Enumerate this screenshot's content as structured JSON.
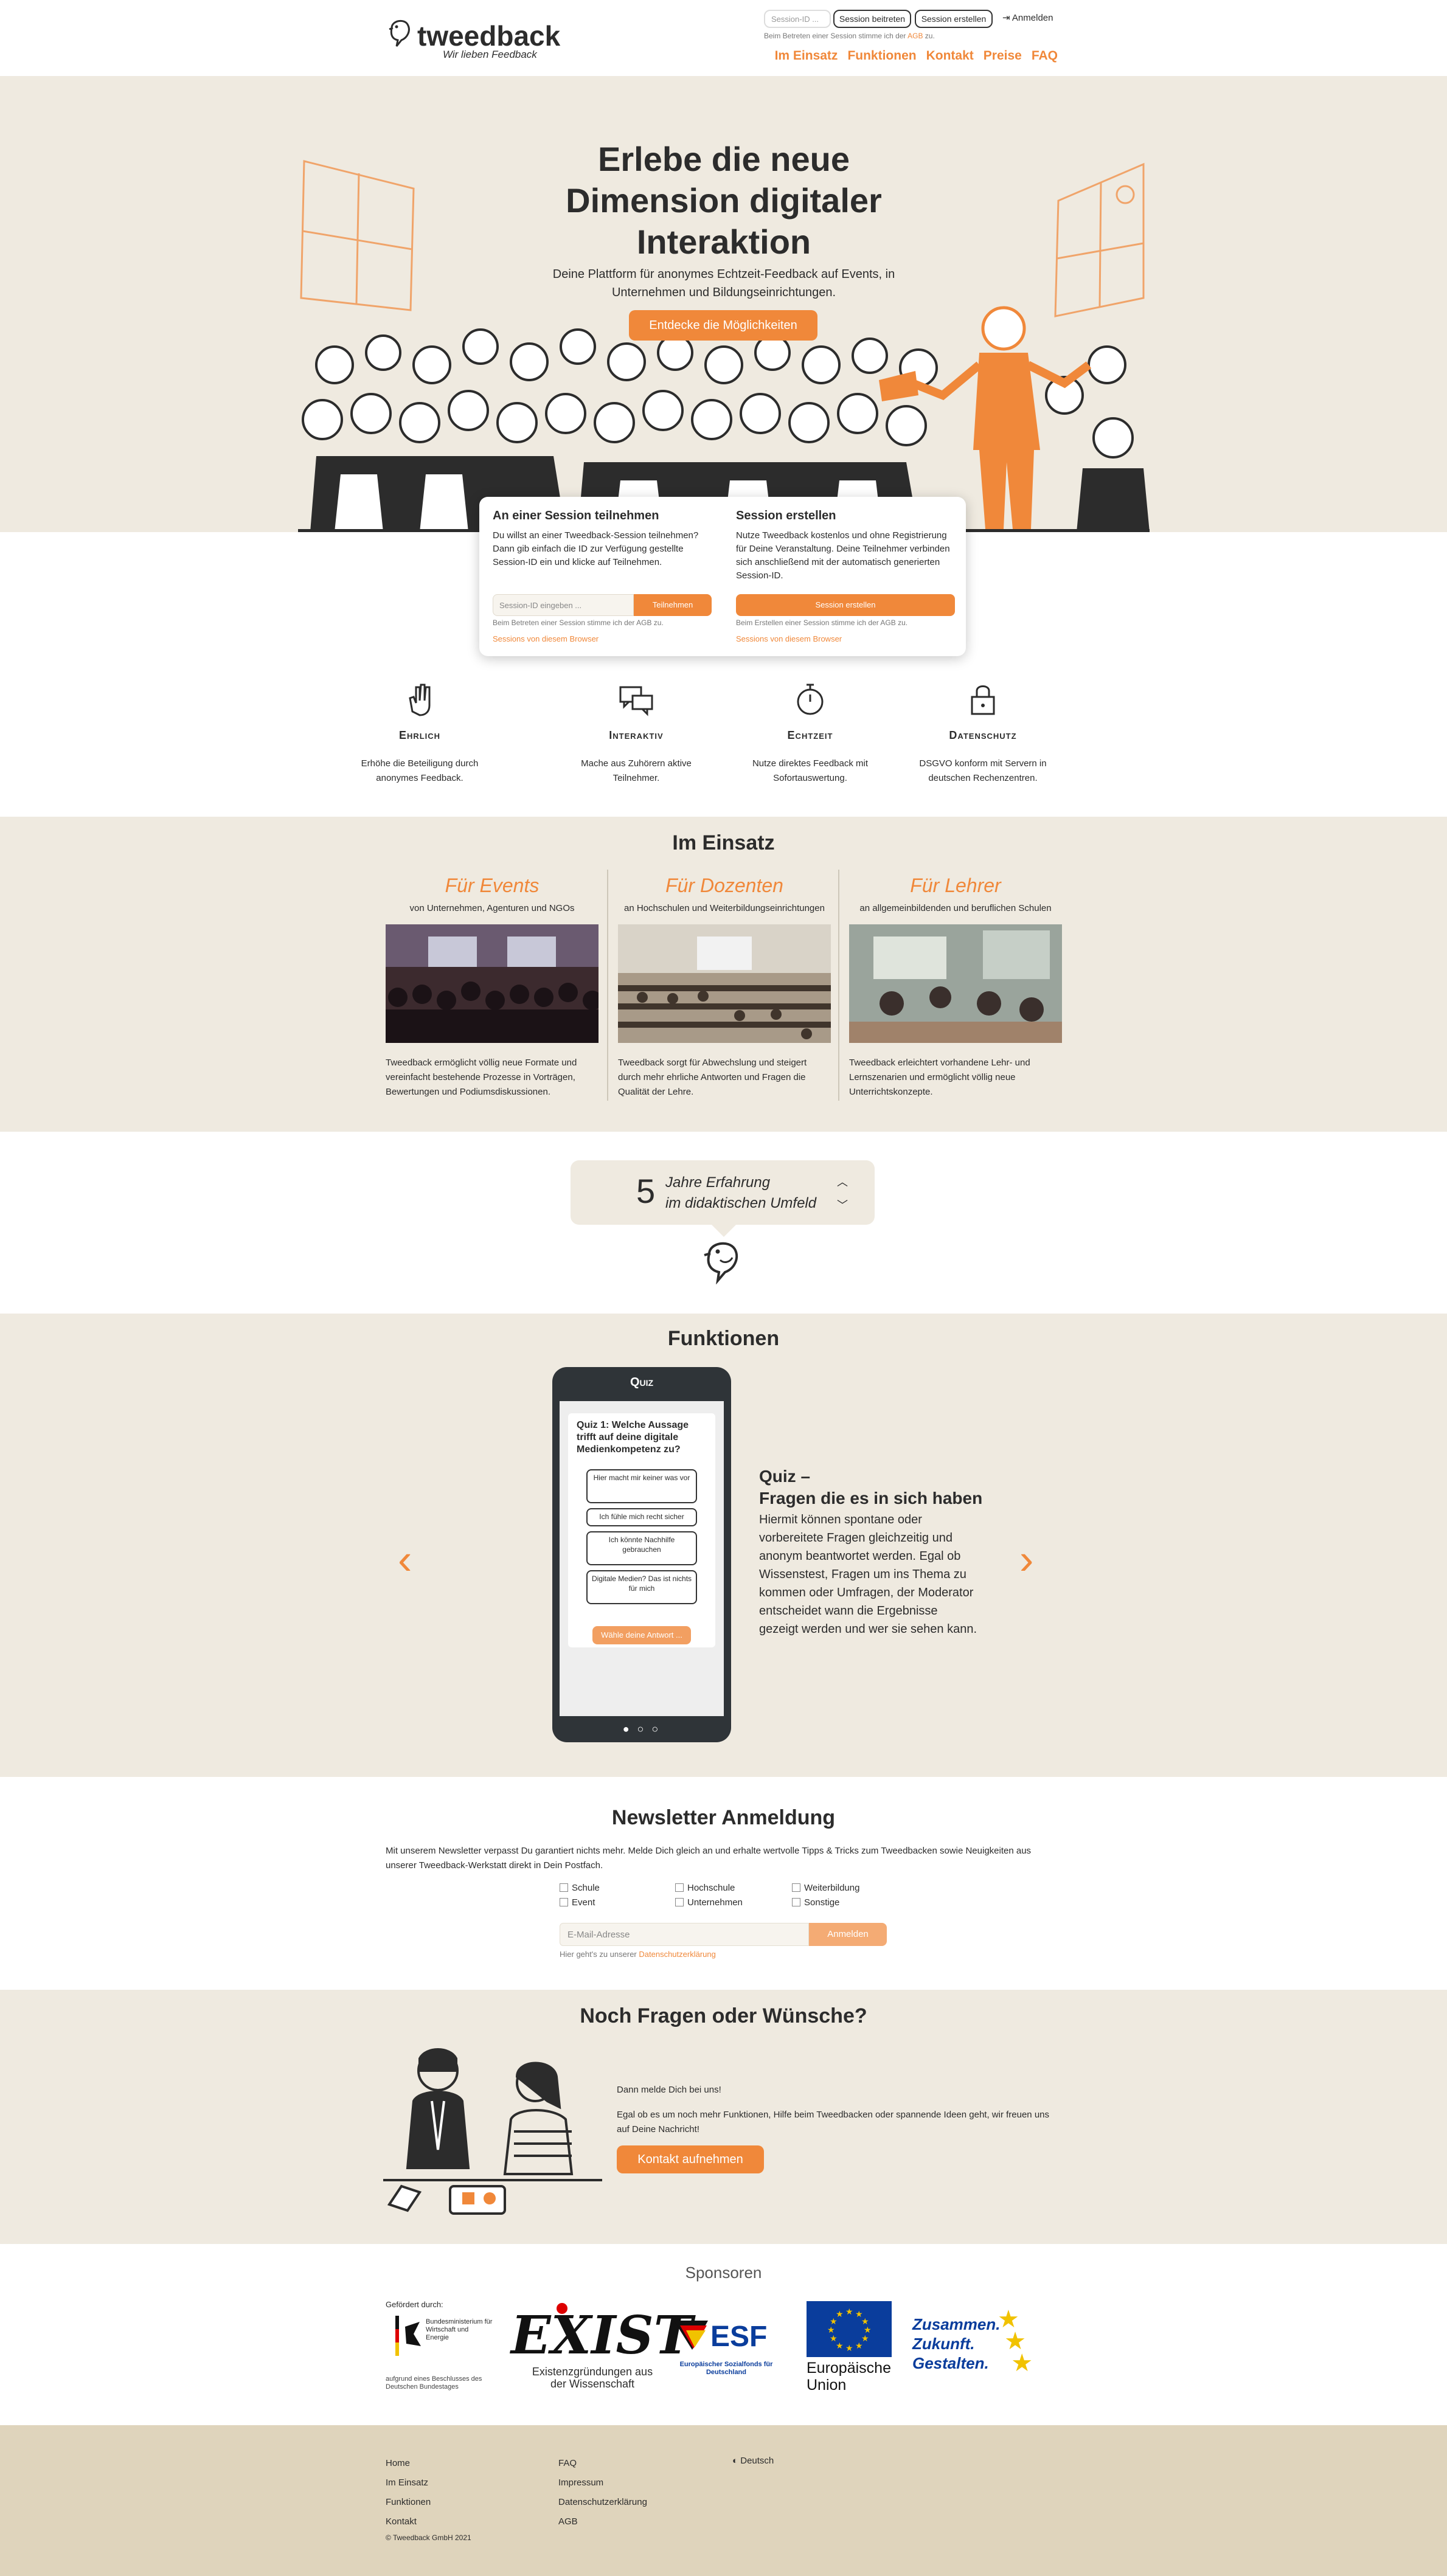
{
  "header": {
    "logo_text": "tweedback",
    "tagline": "Wir lieben Feedback",
    "session_placeholder": "Session-ID ...",
    "join_label": "Session beitreten",
    "create_label": "Session erstellen",
    "login_label": "Anmelden",
    "hint_prefix": "Beim Betreten einer Session stimme ich der ",
    "hint_link": "AGB",
    "hint_suffix": " zu.",
    "nav": [
      "Im Einsatz",
      "Funktionen",
      "Kontakt",
      "Preise",
      "FAQ"
    ]
  },
  "hero": {
    "title": "Erlebe die neue Dimension digitaler Interaktion",
    "subtitle": "Deine Plattform für anonymes Echtzeit-Feedback auf Events, in Unternehmen und Bildungseinrichtungen.",
    "cta": "Entdecke die Möglichkeiten"
  },
  "session_box": {
    "join": {
      "title": "An einer Session teilnehmen",
      "text": "Du willst an einer Tweedback-Session teilnehmen? Dann gib einfach die ID zur Verfügung gestellte Session-ID ein und klicke auf Teilnehmen.",
      "placeholder": "Session-ID eingeben ...",
      "button": "Teilnehmen",
      "hint": "Beim Betreten einer Session stimme ich der AGB zu.",
      "link": "Sessions von diesem Browser"
    },
    "create": {
      "title": "Session erstellen",
      "text": "Nutze Tweedback kostenlos und ohne Registrierung für Deine Veranstaltung. Deine Teilnehmer verbinden sich anschließend mit der automatisch generierten Session-ID.",
      "button": "Session erstellen",
      "hint": "Beim Erstellen einer Session stimme ich der AGB zu.",
      "link": "Sessions von diesem Browser"
    }
  },
  "features": [
    {
      "title": "Ehrlich",
      "text": "Erhöhe die Beteiligung durch anonymes Feedback.",
      "icon": "hand-icon"
    },
    {
      "title": "Interaktiv",
      "text": "Mache aus Zuhörern aktive Teilnehmer.",
      "icon": "chat-bubbles-icon"
    },
    {
      "title": "Echtzeit",
      "text": "Nutze direktes Feedback mit Sofortauswertung.",
      "icon": "stopwatch-icon"
    },
    {
      "title": "Datenschutz",
      "text": "DSGVO konform mit Servern in deutschen Rechenzentren.",
      "icon": "lock-icon"
    }
  ],
  "einsatz": {
    "title": "Im Einsatz",
    "columns": [
      {
        "title": "Für Events",
        "sub": "von Unternehmen, Agenturen und NGOs",
        "text": "Tweedback ermöglicht völlig neue Formate und vereinfacht bestehende Prozesse in Vorträgen, Bewertungen und Podiumsdiskussionen."
      },
      {
        "title": "Für Dozenten",
        "sub": "an Hochschulen und Weiterbildungseinrichtungen",
        "text": "Tweedback sorgt für Abwechslung und steigert durch mehr ehrliche Antworten und Fragen die Qualität der Lehre."
      },
      {
        "title": "Für Lehrer",
        "sub": "an allgemeinbildenden und beruflichen Schulen",
        "text": "Tweedback erleichtert vorhandene Lehr- und Lernszenarien und ermöglicht völlig neue Unterrichtskonzepte."
      }
    ]
  },
  "experience": {
    "number": "5",
    "line1": "Jahre Erfahrung",
    "line2": "im didaktischen Umfeld"
  },
  "funktionen": {
    "title": "Funktionen",
    "phone_title": "Quiz",
    "question": "Quiz 1: Welche Aussage trifft auf deine digitale Medienkompetenz zu?",
    "options": [
      "Hier macht mir keiner was vor",
      "Ich fühle mich recht sicher",
      "Ich könnte Nachhilfe gebrauchen",
      "Digitale Medien? Das ist nichts für mich"
    ],
    "submit": "Wähle deine Antwort ...",
    "heading1": "Quiz  –",
    "heading2": "Fragen die es in sich haben",
    "text": "Hiermit können spontane oder vorbereitete Fragen gleichzeitig und anonym beantwortet werden. Egal ob Wissenstest, Fragen um ins Thema zu kommen oder Umfragen, der Moderator entscheidet wann die Ergebnisse gezeigt werden und wer sie sehen kann."
  },
  "newsletter": {
    "title": "Newsletter Anmeldung",
    "text": "Mit unserem Newsletter verpasst Du garantiert nichts mehr. Melde Dich gleich an und erhalte wertvolle Tipps & Tricks zum Tweedbacken sowie Neuigkeiten aus unserer Tweedback-Werkstatt direkt in Dein Postfach.",
    "options": [
      "Schule",
      "Hochschule",
      "Weiterbildung",
      "Event",
      "Unternehmen",
      "Sonstige"
    ],
    "placeholder": "E-Mail-Adresse",
    "button": "Anmelden",
    "hint_prefix": "Hier geht's zu unserer ",
    "hint_link": "Datenschutzerklärung"
  },
  "fragen": {
    "title": "Noch Fragen oder Wünsche?",
    "line1": "Dann melde Dich bei uns!",
    "line2": "Egal ob es um noch mehr Funktionen, Hilfe beim Tweedbacken oder spannende Ideen geht, wir freuen uns auf Deine Nachricht!",
    "button": "Kontakt aufnehmen"
  },
  "sponsors": {
    "title": "Sponsoren",
    "gefoerdert": "Gefördert durch:",
    "bmwi": "Bundesministerium für Wirtschaft und Energie",
    "bmwi_note": "aufgrund eines Beschlusses des Deutschen Bundestages",
    "exist": "EXIST",
    "exist_sub": "Existenzgründungen aus der Wissenschaft",
    "esf": "ESF",
    "esf_sub": "Europäischer Sozialfonds für Deutschland",
    "eu": "Europäische Union",
    "zzg": "Zusammen. Zukunft. Gestalten."
  },
  "footer": {
    "col1": [
      "Home",
      "Im Einsatz",
      "Funktionen",
      "Kontakt"
    ],
    "col2": [
      "FAQ",
      "Impressum",
      "Datenschutzerklärung",
      "AGB"
    ],
    "language": "Deutsch",
    "copyright": "© Tweedback GmbH 2021"
  },
  "colors": {
    "accent": "#f0883a",
    "beige": "#efeae0",
    "footer": "#dfd4bc",
    "dark": "#2f3438"
  }
}
